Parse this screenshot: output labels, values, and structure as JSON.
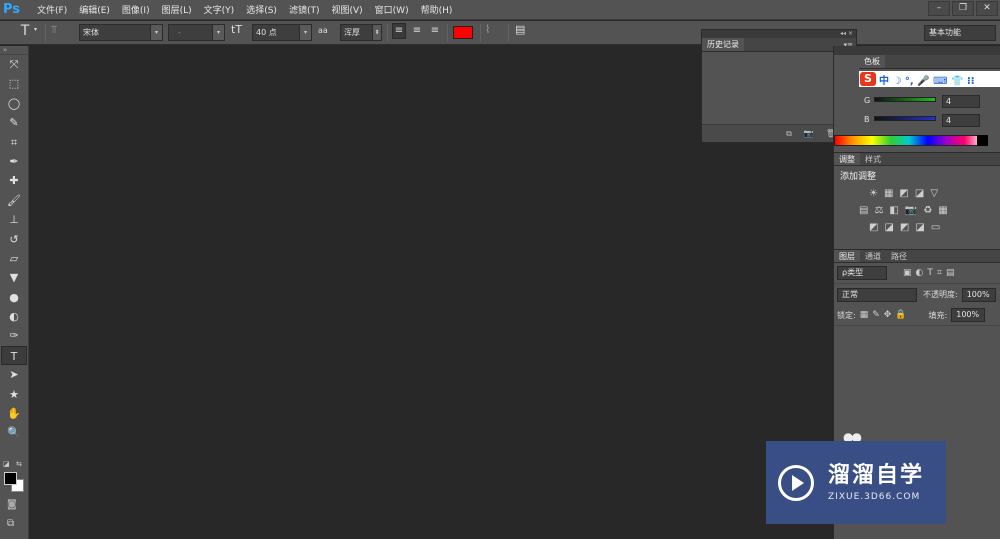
{
  "app": {
    "logo": "Ps"
  },
  "menu": [
    "文件(F)",
    "编辑(E)",
    "图像(I)",
    "图层(L)",
    "文字(Y)",
    "选择(S)",
    "滤镜(T)",
    "视图(V)",
    "窗口(W)",
    "帮助(H)"
  ],
  "window_controls": [
    "–",
    "❐",
    "✕"
  ],
  "options_bar": {
    "tool_icon": "T",
    "font_family": "宋体",
    "font_style": "-",
    "size_icon": "tT",
    "font_size": "40 点",
    "aa_icon": "aa",
    "antialias": "浑厚",
    "text_color": "#ff0000",
    "workspace": "基本功能"
  },
  "toolbar": {
    "grip": "»",
    "tools": [
      "move-icon",
      "marquee-icon",
      "lasso-icon",
      "quick-select-icon",
      "crop-icon",
      "eyedropper-icon",
      "healing-icon",
      "brush-icon",
      "stamp-icon",
      "history-brush-icon",
      "eraser-icon",
      "bucket-icon",
      "blur-icon",
      "dodge-icon",
      "pen-icon",
      "type-icon",
      "path-select-icon",
      "shape-icon",
      "hand-icon",
      "zoom-icon"
    ],
    "tool_glyphs": [
      "⤧",
      "⬚",
      "◯",
      "✎",
      "⌗",
      "✒",
      "✚",
      "🖌",
      "⊥",
      "↺",
      "▱",
      "▼",
      "●",
      "◐",
      "✑",
      "T",
      "➤",
      "★",
      "✋",
      "🔍"
    ],
    "active_index": 15,
    "foreground_color": "#000000",
    "background_color": "#ffffff"
  },
  "history_panel": {
    "collapse": "◂◂ ×",
    "tab": "历史记录",
    "menu": "▾≡",
    "footer_icons": [
      "⧉",
      "📷",
      "🗑"
    ]
  },
  "swatches_panel": {
    "tab": "色板",
    "ime_logo": "S",
    "ime_text": "中 ☽ °, 🎤 ⌨ 👕 ⁝⁝",
    "channels": [
      {
        "label": "G",
        "value": "4",
        "color": "#22bb22"
      },
      {
        "label": "B",
        "value": "4",
        "color": "#2233cc"
      }
    ]
  },
  "adjustments_panel": {
    "tabs": [
      "调整",
      "样式"
    ],
    "title": "添加调整",
    "icon_rows": [
      [
        "☀",
        "▦",
        "◩",
        "◪",
        "▽"
      ],
      [
        "▤",
        "⚖",
        "◧",
        "📷",
        "♻",
        "▦"
      ],
      [
        "◩",
        "◪",
        "◩",
        "◪",
        "▭"
      ]
    ]
  },
  "layers_panel": {
    "tabs": [
      "图层",
      "通道",
      "路径"
    ],
    "filter_label": "ρ类型",
    "filter_icons": [
      "▣",
      "◐",
      "T",
      "⌗",
      "▤"
    ],
    "blend_mode": "正常",
    "opacity_label": "不透明度:",
    "opacity_value": "100%",
    "lock_label": "锁定:",
    "lock_icons": [
      "▦",
      "✎",
      "✥",
      "🔒"
    ],
    "fill_label": "填充:",
    "fill_value": "100%"
  },
  "watermark": {
    "title": "溜溜自学",
    "url": "ZIXUE.3D66.COM",
    "tail": "●●"
  }
}
